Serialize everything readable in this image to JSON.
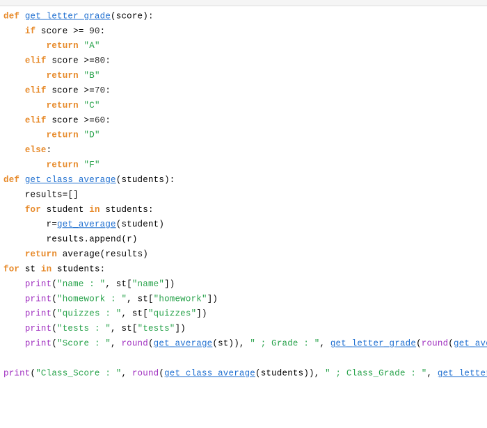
{
  "code": {
    "def1": "def",
    "fn_get_letter_grade": "get_letter_grade",
    "open_paren": "(",
    "close_paren": ")",
    "score": "score",
    "colon": ":",
    "if": "if",
    "elif": "elif",
    "else": "else",
    "return": "return",
    "ge": ">=",
    "n90": " 90",
    "n80": "80",
    "n70": "70",
    "n60": "60",
    "strA": "\"A\"",
    "strB": "\"B\"",
    "strC": "\"C\"",
    "strD": "\"D\"",
    "strF": "\"F\"",
    "fn_get_class_average": "get_class_average",
    "students": "students",
    "results": "results",
    "eq": "=",
    "empty_list": "[]",
    "for": "for",
    "in": "in",
    "student": "student",
    "r": "r",
    "fn_get_average": "get_average",
    "append": ".append",
    "average": "average",
    "st": "st",
    "print": "print",
    "comma": ", ",
    "str_name": "\"name : \"",
    "key_name": "\"name\"",
    "str_homework": "\"homework : \"",
    "key_homework": "\"homework\"",
    "str_quizzes": "\"quizzes : \"",
    "key_quizzes": "\"quizzes\"",
    "str_tests": "\"tests : \"",
    "key_tests": "\"tests\"",
    "str_score": "\"Score : \"",
    "round": "round",
    "str_grade": "\" ; Grade : \"",
    "str_class_score": "\"Class_Score : \"",
    "str_class_grade": "\" ; Class_Grade : \"",
    "lbr": "[",
    "rbr": "]"
  }
}
